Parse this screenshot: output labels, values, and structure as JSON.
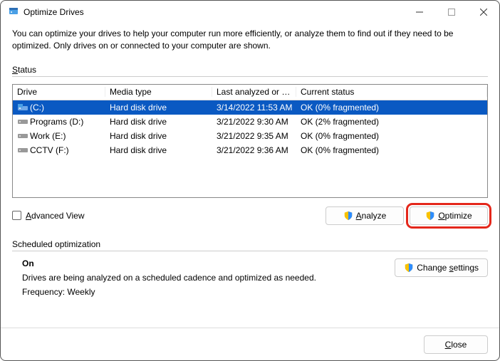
{
  "window": {
    "title": "Optimize Drives"
  },
  "description": "You can optimize your drives to help your computer run more efficiently, or analyze them to find out if they need to be optimized. Only drives on or connected to your computer are shown.",
  "status_label": "Status",
  "columns": {
    "drive": "Drive",
    "media": "Media type",
    "last": "Last analyzed or o...",
    "status": "Current status"
  },
  "drives": [
    {
      "name": "(C:)",
      "media": "Hard disk drive",
      "last": "3/14/2022 11:53 AM",
      "status": "OK (0% fragmented)",
      "selected": true,
      "icon": "os"
    },
    {
      "name": "Programs (D:)",
      "media": "Hard disk drive",
      "last": "3/21/2022 9:30 AM",
      "status": "OK (2% fragmented)",
      "selected": false,
      "icon": "hdd"
    },
    {
      "name": "Work (E:)",
      "media": "Hard disk drive",
      "last": "3/21/2022 9:35 AM",
      "status": "OK (0% fragmented)",
      "selected": false,
      "icon": "hdd"
    },
    {
      "name": "CCTV (F:)",
      "media": "Hard disk drive",
      "last": "3/21/2022 9:36 AM",
      "status": "OK (0% fragmented)",
      "selected": false,
      "icon": "hdd"
    }
  ],
  "advanced_view": {
    "label": "Advanced View",
    "checked": false
  },
  "buttons": {
    "analyze": "Analyze",
    "optimize": "Optimize",
    "change_settings": "Change settings",
    "close": "Close"
  },
  "scheduled": {
    "heading": "Scheduled optimization",
    "on": "On",
    "desc": "Drives are being analyzed on a scheduled cadence and optimized as needed.",
    "freq": "Frequency: Weekly"
  }
}
